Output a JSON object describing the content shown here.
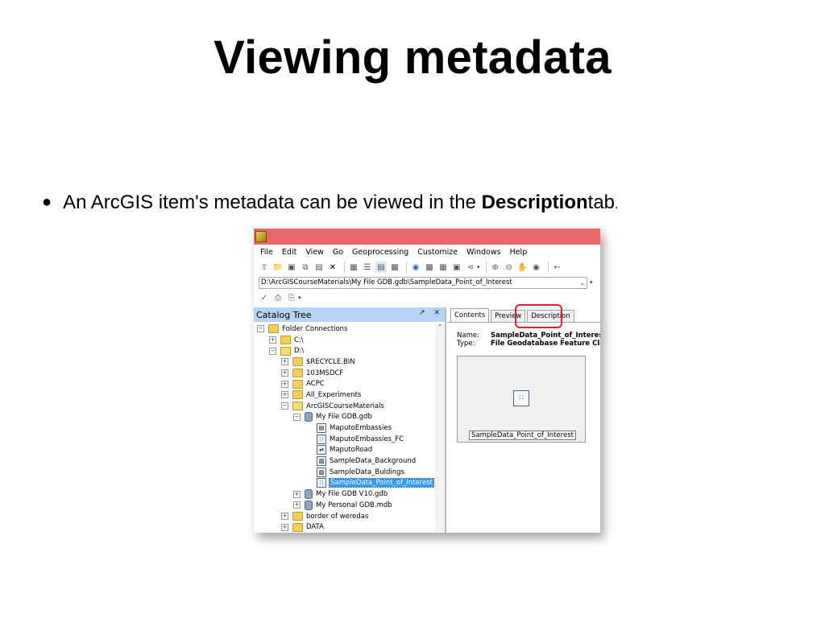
{
  "slide": {
    "title": "Viewing metadata",
    "bullet_prefix": "An ArcGIS item's metadata can be viewed in the ",
    "bullet_bold": "Description",
    "bullet_suffix": " tab",
    "bullet_period": "."
  },
  "window": {
    "titlebar_color": "#e9696b",
    "menu": [
      "File",
      "Edit",
      "View",
      "Go",
      "Geoprocessing",
      "Customize",
      "Windows",
      "Help"
    ],
    "location_path": "D:\\ArcGISCourseMaterials\\My File GDB.gdb\\SampleData_Point_of_Interest"
  },
  "catalog": {
    "header": "Catalog Tree",
    "header_buttons": [
      "↗",
      "✕"
    ],
    "tree": [
      {
        "label": "Folder Connections",
        "depth": 0,
        "expander": "−",
        "icon": "folder-connection-icon"
      },
      {
        "label": "C:\\",
        "depth": 1,
        "expander": "+",
        "icon": "folder-icon"
      },
      {
        "label": "D:\\",
        "depth": 1,
        "expander": "−",
        "icon": "folder-icon"
      },
      {
        "label": "$RECYCLE.BIN",
        "depth": 2,
        "expander": "+",
        "icon": "folder-icon"
      },
      {
        "label": "103MSDCF",
        "depth": 2,
        "expander": "+",
        "icon": "folder-icon"
      },
      {
        "label": "ACPC",
        "depth": 2,
        "expander": "+",
        "icon": "folder-icon"
      },
      {
        "label": "All_Experiments",
        "depth": 2,
        "expander": "+",
        "icon": "folder-icon"
      },
      {
        "label": "ArcGISCourseMaterials",
        "depth": 2,
        "expander": "−",
        "icon": "folder-icon"
      },
      {
        "label": "My File GDB.gdb",
        "depth": 3,
        "expander": "−",
        "icon": "geodatabase-icon"
      },
      {
        "label": "MaputoEmbassies",
        "depth": 4,
        "expander": "",
        "icon": "table-icon"
      },
      {
        "label": "MaputoEmbassies_FC",
        "depth": 4,
        "expander": "",
        "icon": "point-feature-class-icon"
      },
      {
        "label": "MaputoRoad",
        "depth": 4,
        "expander": "",
        "icon": "line-feature-class-icon"
      },
      {
        "label": "SampleData_Background",
        "depth": 4,
        "expander": "",
        "icon": "polygon-feature-class-icon"
      },
      {
        "label": "SampleData_Buldings",
        "depth": 4,
        "expander": "",
        "icon": "polygon-feature-class-icon"
      },
      {
        "label": "SampleData_Point_of_Interest",
        "depth": 4,
        "expander": "",
        "icon": "point-feature-class-icon",
        "selected": true
      },
      {
        "label": "My File GDB V10.gdb",
        "depth": 3,
        "expander": "+",
        "icon": "geodatabase-icon"
      },
      {
        "label": "My Personal GDB.mdb",
        "depth": 3,
        "expander": "+",
        "icon": "geodatabase-icon"
      },
      {
        "label": "border of weredas",
        "depth": 2,
        "expander": "+",
        "icon": "folder-icon"
      },
      {
        "label": "DATA",
        "depth": 2,
        "expander": "+",
        "icon": "folder-icon"
      }
    ]
  },
  "details": {
    "tabs": [
      "Contents",
      "Preview",
      "Description"
    ],
    "active_tab": "Contents",
    "highlighted_tab": "Description",
    "highlight_color": "#e0212b",
    "name_key": "Name:",
    "name_value": "SampleData_Point_of_Interest",
    "type_key": "Type:",
    "type_value": "File Geodatabase Feature Class",
    "thumbnail_caption": "SampleData_Point_of_Interest"
  }
}
